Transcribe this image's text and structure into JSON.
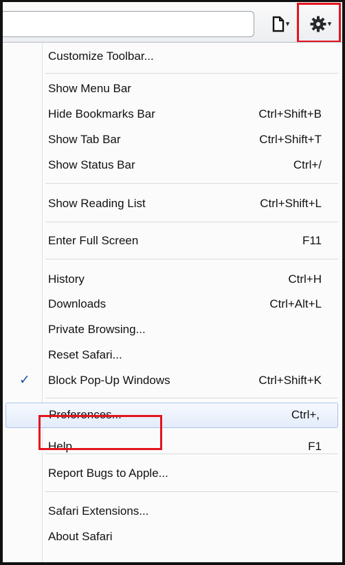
{
  "toolbar": {
    "page_button_icon": "page-icon",
    "gear_button_icon": "gear-icon",
    "caret": "▾"
  },
  "menu": {
    "customize_toolbar": "Customize Toolbar...",
    "show_menu_bar": "Show Menu Bar",
    "hide_bookmarks_bar": {
      "label": "Hide Bookmarks Bar",
      "shortcut": "Ctrl+Shift+B"
    },
    "show_tab_bar": {
      "label": "Show Tab Bar",
      "shortcut": "Ctrl+Shift+T"
    },
    "show_status_bar": {
      "label": "Show Status Bar",
      "shortcut": "Ctrl+/"
    },
    "show_reading_list": {
      "label": "Show Reading List",
      "shortcut": "Ctrl+Shift+L"
    },
    "enter_full_screen": {
      "label": "Enter Full Screen",
      "shortcut": "F11"
    },
    "history": {
      "label": "History",
      "shortcut": "Ctrl+H"
    },
    "downloads": {
      "label": "Downloads",
      "shortcut": "Ctrl+Alt+L"
    },
    "private_browsing": "Private Browsing...",
    "reset_safari": "Reset Safari...",
    "block_popups": {
      "label": "Block Pop-Up Windows",
      "shortcut": "Ctrl+Shift+K",
      "checked": true,
      "check_glyph": "✓"
    },
    "preferences": {
      "label": "Preferences...",
      "shortcut": "Ctrl+,"
    },
    "help": {
      "label": "Help",
      "shortcut": "F1"
    },
    "report_bugs": "Report Bugs to Apple...",
    "safari_extensions": "Safari Extensions...",
    "about_safari": "About Safari"
  },
  "colors": {
    "highlight_annotation": "#e3141d",
    "hover_row": "#e3ecfb",
    "check": "#1f4fa8"
  }
}
